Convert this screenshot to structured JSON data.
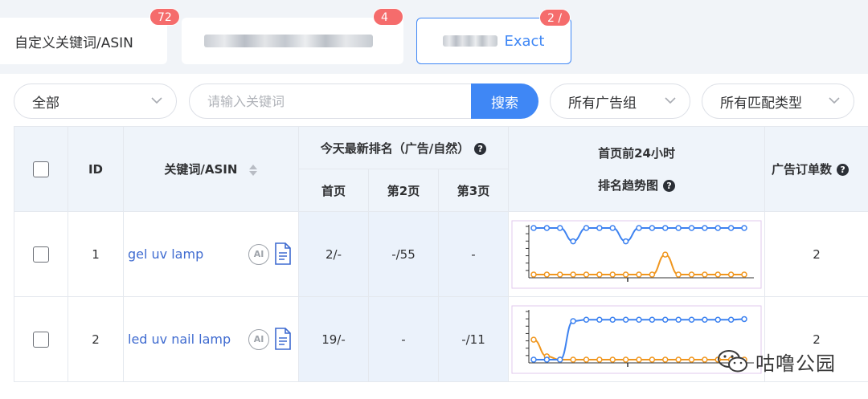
{
  "tabs": [
    {
      "label": "自定义关键词/ASIN",
      "badge": "72",
      "blurred": false
    },
    {
      "label": "",
      "badge": "4 / 4",
      "blurred": true
    },
    {
      "label": "Exact",
      "badge": "2 / 2",
      "blurred": true,
      "active": true
    }
  ],
  "filters": {
    "scope_select": "全部",
    "search_placeholder": "请输入关键词",
    "search_button": "搜索",
    "ad_group_select": "所有广告组",
    "match_type_select": "所有匹配类型"
  },
  "table": {
    "headers": {
      "id": "ID",
      "keyword": "关键词/ASIN",
      "rank_group": "今天最新排名（广告/自然）",
      "page1": "首页",
      "page2": "第2页",
      "page3": "第3页",
      "trend_line1": "首页前24小时",
      "trend_line2": "排名趋势图",
      "orders": "广告订单数"
    },
    "rows": [
      {
        "id": "1",
        "keyword": "gel uv lamp",
        "ai_badge": "AI",
        "page1": "2/-",
        "page2": "-/55",
        "page3": "-",
        "orders": "2",
        "trend_ad": [
          1,
          1,
          1,
          3,
          1,
          1,
          1,
          3,
          1,
          1,
          1,
          1,
          1,
          1,
          1,
          1,
          1
        ],
        "trend_organic": [
          8,
          8,
          8,
          8,
          8,
          8,
          8,
          8,
          8,
          8,
          5,
          8,
          8,
          8,
          8,
          8,
          8
        ]
      },
      {
        "id": "2",
        "keyword": "led uv nail lamp",
        "ai_badge": "AI",
        "page1": "19/-",
        "page2": "-",
        "page3": "-/11",
        "orders": "2",
        "trend_ad": [
          8,
          8,
          8,
          2.2,
          2,
          2,
          2,
          2,
          2,
          2,
          2,
          2,
          2,
          2,
          2,
          2,
          1.9
        ],
        "trend_organic": [
          5,
          7.5,
          8,
          8,
          8,
          8,
          8,
          8,
          8,
          8,
          8,
          8,
          8,
          8,
          8,
          8,
          8
        ]
      }
    ]
  },
  "colors": {
    "accent": "#3f87f5",
    "ad_line": "#3d82f0",
    "organic_line": "#f0961e",
    "badge": "#f56c6c"
  },
  "watermark": "咕噜公园"
}
